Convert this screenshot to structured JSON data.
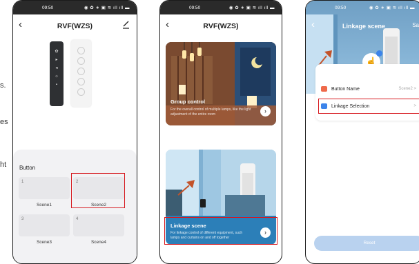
{
  "side_text": {
    "line1": "s.",
    "line2": "es",
    "line3": "ht"
  },
  "status_bar": {
    "time": "09:50",
    "icons": "◉ ✿ ∗ ▣ ≋ ıll ıll ▬"
  },
  "screen1": {
    "title": "RVF(WZS)",
    "sheet_title": "Button",
    "scenes": [
      {
        "num": "1",
        "label": "Scene1"
      },
      {
        "num": "2",
        "label": "Scene2"
      },
      {
        "num": "3",
        "label": "Scene3"
      },
      {
        "num": "4",
        "label": "Scene4"
      }
    ]
  },
  "screen2": {
    "title": "RVF(WZS)",
    "group": {
      "title": "Group control",
      "desc": "For the overall control of multiple lamps, like the light adjustment of the entire room"
    },
    "linkage": {
      "title": "Linkage scene",
      "desc": "For linkage control of different equipment, such lamps and curtains on and off together"
    }
  },
  "screen3": {
    "title": "Linkage scene",
    "save_label": "Sav",
    "rows": [
      {
        "label": "Button Name",
        "value": "Scene2 >"
      },
      {
        "label": "Linkage Selection",
        "value": ">"
      }
    ],
    "reset_label": "Reset"
  },
  "colors": {
    "highlight": "#d6181e",
    "status_bar": "#2a2a2a",
    "accent": "#3c84ea",
    "reset": "#b9d2ef"
  }
}
